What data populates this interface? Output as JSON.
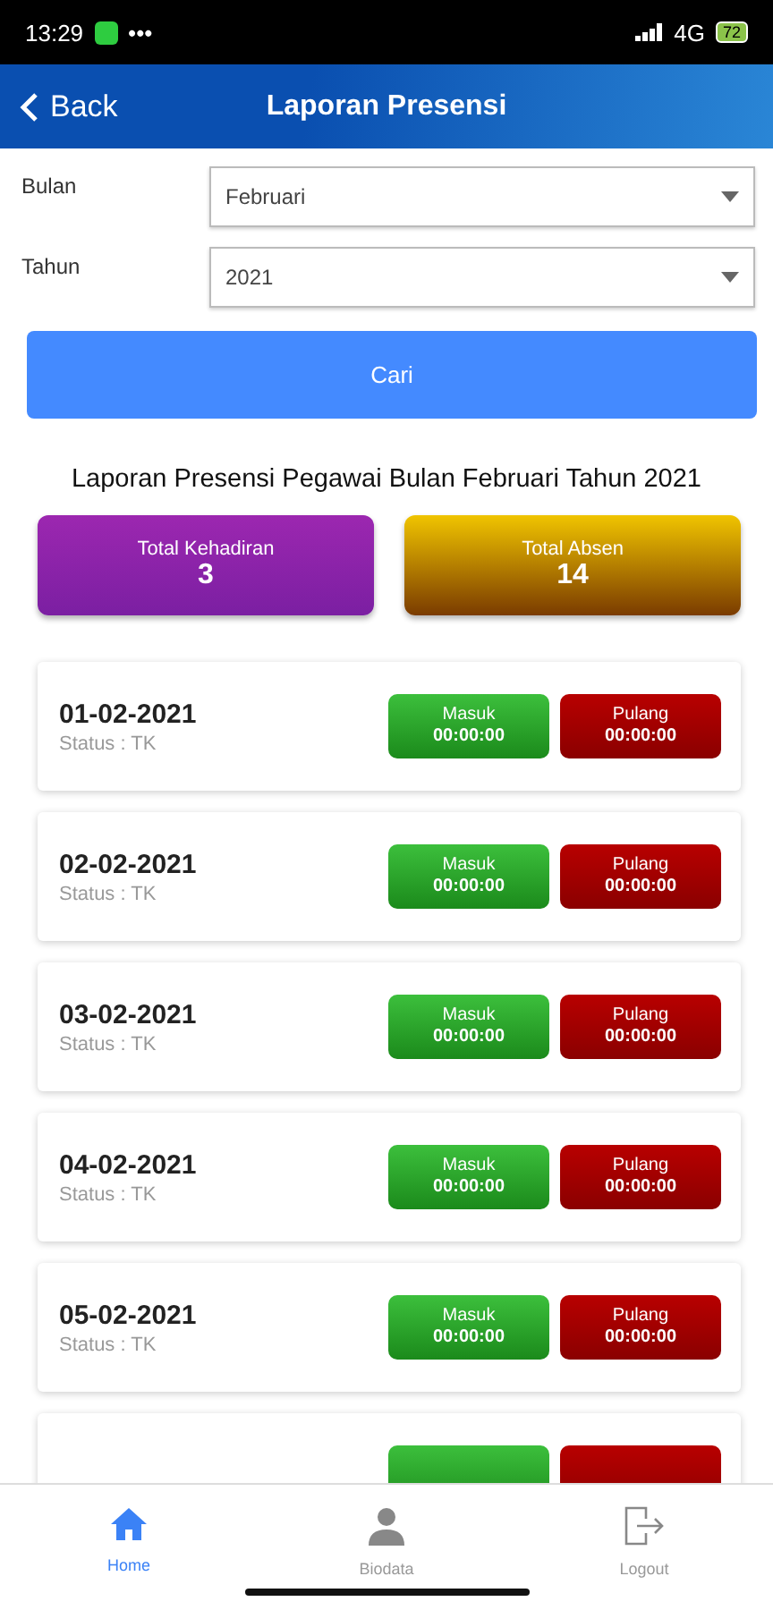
{
  "status_bar": {
    "time": "13:29",
    "dots": "•••",
    "network": "4G",
    "battery": "72"
  },
  "header": {
    "back": "Back",
    "title": "Laporan Presensi"
  },
  "form": {
    "fields": [
      {
        "label": "Bulan",
        "value": "Februari"
      },
      {
        "label": "Tahun",
        "value": "2021"
      }
    ],
    "button": "Cari"
  },
  "report_title": "Laporan Presensi Pegawai Bulan Februari Tahun 2021",
  "summary": [
    {
      "label": "Total Kehadiran",
      "value": "3",
      "kind": "present"
    },
    {
      "label": "Total Absen",
      "value": "14",
      "kind": "absent"
    }
  ],
  "records": [
    {
      "date": "01-02-2021",
      "status": "Status : TK",
      "in_label": "Masuk",
      "in_time": "00:00:00",
      "out_label": "Pulang",
      "out_time": "00:00:00"
    },
    {
      "date": "02-02-2021",
      "status": "Status : TK",
      "in_label": "Masuk",
      "in_time": "00:00:00",
      "out_label": "Pulang",
      "out_time": "00:00:00"
    },
    {
      "date": "03-02-2021",
      "status": "Status : TK",
      "in_label": "Masuk",
      "in_time": "00:00:00",
      "out_label": "Pulang",
      "out_time": "00:00:00"
    },
    {
      "date": "04-02-2021",
      "status": "Status : TK",
      "in_label": "Masuk",
      "in_time": "00:00:00",
      "out_label": "Pulang",
      "out_time": "00:00:00"
    },
    {
      "date": "05-02-2021",
      "status": "Status : TK",
      "in_label": "Masuk",
      "in_time": "00:00:00",
      "out_label": "Pulang",
      "out_time": "00:00:00"
    }
  ],
  "nav": [
    {
      "label": "Home",
      "kind": "home",
      "selected": true
    },
    {
      "label": "Biodata",
      "kind": "person",
      "selected": false
    },
    {
      "label": "Logout",
      "kind": "logout",
      "selected": false
    }
  ]
}
